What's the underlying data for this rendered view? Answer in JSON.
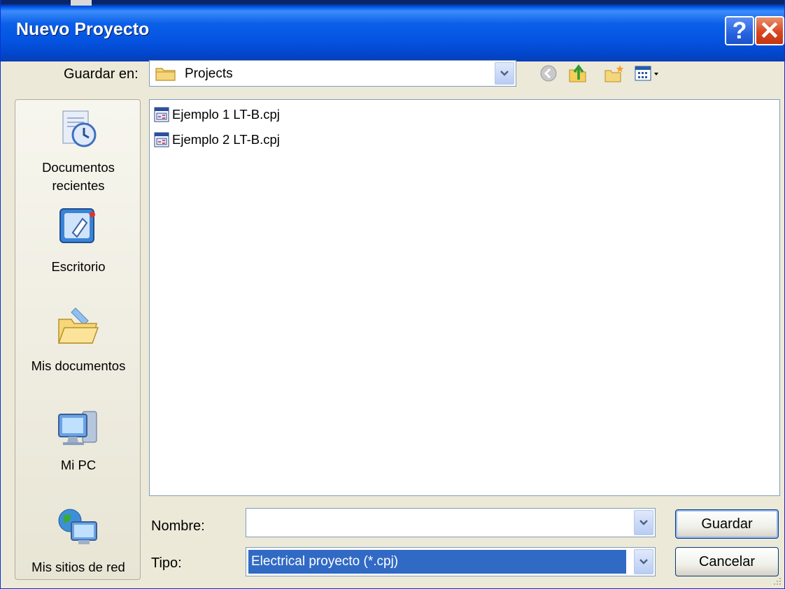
{
  "window": {
    "title": "Nuevo Proyecto",
    "help_glyph": "?",
    "close_glyph": "✕"
  },
  "toolbar": {
    "look_in_label": "Guardar en:",
    "look_in_value": "Projects",
    "icons": [
      "back-icon",
      "up-folder-icon",
      "new-folder-icon",
      "views-menu-icon"
    ]
  },
  "places": [
    {
      "label": "Documentos recientes",
      "icon": "recent-documents-icon"
    },
    {
      "label": "Escritorio",
      "icon": "desktop-icon"
    },
    {
      "label": "Mis documentos",
      "icon": "my-documents-icon"
    },
    {
      "label": "Mi PC",
      "icon": "my-computer-icon"
    },
    {
      "label": "Mis sitios de red",
      "icon": "network-places-icon"
    }
  ],
  "files": [
    {
      "name": "Ejemplo 1 LT-B.cpj",
      "icon": "cpj-file-icon"
    },
    {
      "name": "Ejemplo 2 LT-B.cpj",
      "icon": "cpj-file-icon"
    }
  ],
  "form": {
    "name_label": "Nombre:",
    "name_value": "",
    "type_label": "Tipo:",
    "type_value": "Electrical proyecto (*.cpj)"
  },
  "buttons": {
    "save": "Guardar",
    "cancel": "Cancelar"
  },
  "colors": {
    "titlebar": "#0453e0",
    "selection": "#316ac5",
    "dialog_bg": "#ece9d8"
  }
}
